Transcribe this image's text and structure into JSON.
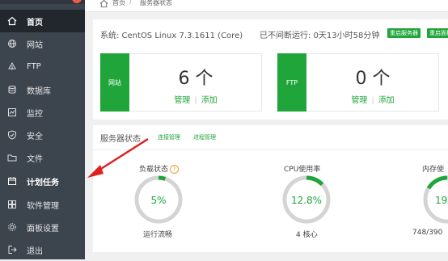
{
  "sidebar": {
    "items": [
      {
        "label": "首页",
        "icon": "home-icon",
        "active": true
      },
      {
        "label": "网站",
        "icon": "globe-icon"
      },
      {
        "label": "FTP",
        "icon": "ftp-icon"
      },
      {
        "label": "数据库",
        "icon": "database-icon"
      },
      {
        "label": "监控",
        "icon": "monitor-icon"
      },
      {
        "label": "安全",
        "icon": "shield-icon"
      },
      {
        "label": "文件",
        "icon": "folder-icon"
      },
      {
        "label": "计划任务",
        "icon": "calendar-icon",
        "highlighted": true
      },
      {
        "label": "软件管理",
        "icon": "app-icon"
      },
      {
        "label": "面板设置",
        "icon": "gear-icon"
      },
      {
        "label": "退出",
        "icon": "logout-icon"
      }
    ]
  },
  "breadcrumb": {
    "home": "首页",
    "sep": "/",
    "current": "服务器状态"
  },
  "system": {
    "info": "系统: CentOS Linux 7.3.1611 (Core)",
    "uptime": "已不间断运行: 0天13小时58分钟",
    "restart_server": "重启服务器",
    "restart_panel": "重启面板"
  },
  "cards": {
    "website": {
      "tag": "网站",
      "count": "6 个",
      "manage": "管理",
      "sep": "|",
      "add": "添加"
    },
    "ftp": {
      "tag": "FTP",
      "count": "0 个",
      "manage": "管理",
      "sep": "|",
      "add": "添加"
    }
  },
  "status": {
    "title": "服务器状态",
    "link_conn": "连接管理",
    "link_proc": "进程管理",
    "load": {
      "label": "负载状态",
      "value": "5%",
      "percent": 5,
      "sub": "运行流畅",
      "help": "?"
    },
    "cpu": {
      "label": "CPU使用率",
      "value": "12.8%",
      "percent": 12.8,
      "sub": "4 核心"
    },
    "mem": {
      "label": "内存使",
      "value": "19",
      "sub": "748/390"
    }
  },
  "colors": {
    "accent": "#20a53a",
    "sidebar": "#3c444d",
    "arrow": "#e02020"
  }
}
